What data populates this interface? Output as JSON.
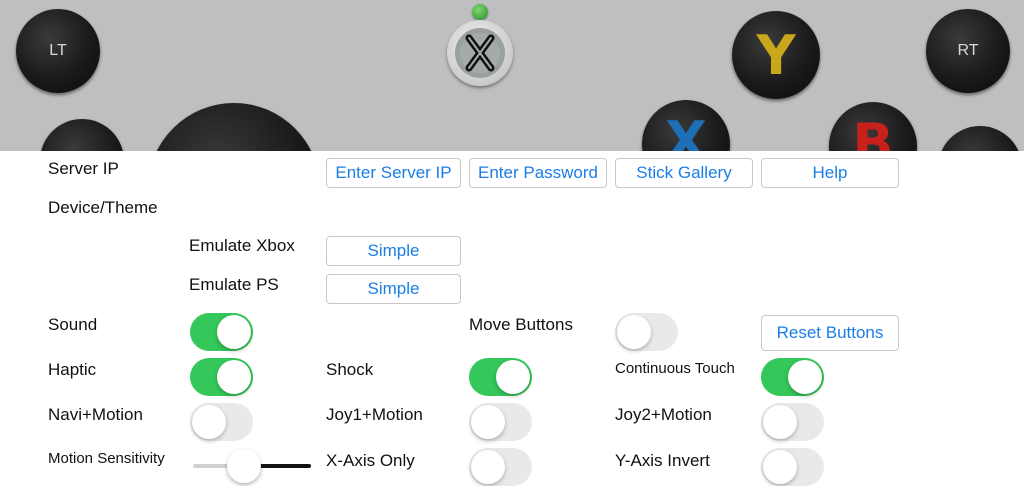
{
  "controller": {
    "lt_label": "LT",
    "rt_label": "RT",
    "y_label": "Y",
    "x_label": "X",
    "b_label": "B",
    "colors": {
      "y": "#c9a71a",
      "x": "#1e6fb5",
      "b": "#c8211c",
      "status_led": "#3fa63c"
    }
  },
  "settings": {
    "server_ip_label": "Server IP",
    "enter_server_ip": "Enter Server IP",
    "enter_password": "Enter Password",
    "stick_gallery": "Stick Gallery",
    "help": "Help",
    "device_theme_label": "Device/Theme",
    "emulate_xbox_label": "Emulate Xbox",
    "emulate_xbox_value": "Simple",
    "emulate_ps_label": "Emulate PS",
    "emulate_ps_value": "Simple",
    "sound_label": "Sound",
    "sound_on": true,
    "move_buttons_label": "Move Buttons",
    "move_buttons_on": false,
    "reset_buttons": "Reset Buttons",
    "haptic_label": "Haptic",
    "haptic_on": true,
    "shock_label": "Shock",
    "shock_on": true,
    "continuous_touch_label": "Continuous Touch",
    "continuous_touch_on": true,
    "navi_motion_label": "Navi+Motion",
    "navi_motion_on": false,
    "joy1_motion_label": "Joy1+Motion",
    "joy1_motion_on": false,
    "joy2_motion_label": "Joy2+Motion",
    "joy2_motion_on": false,
    "motion_sensitivity_label": "Motion Sensitivity",
    "motion_sensitivity_value": 0.4,
    "x_axis_only_label": "X-Axis Only",
    "x_axis_only_on": false,
    "y_axis_invert_label": "Y-Axis Invert",
    "y_axis_invert_on": false
  }
}
